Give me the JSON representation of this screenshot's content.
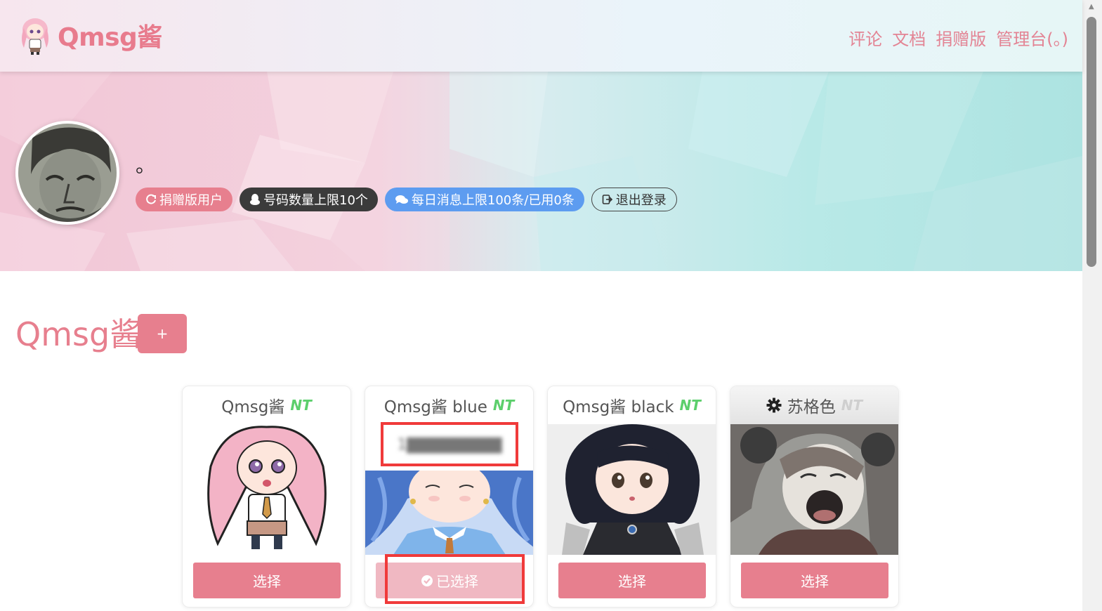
{
  "nav": {
    "brand": "Qmsg酱",
    "links": [
      "评论",
      "文档",
      "捐赠版",
      "管理台(。)"
    ]
  },
  "profile": {
    "username": "。",
    "badges": {
      "donate": "捐赠版用户",
      "qq_limit": "号码数量上限10个",
      "msg_limit": "每日消息上限100条/已用0条",
      "logout": "退出登录"
    }
  },
  "section": {
    "title": "Qmsg酱",
    "add_label": "+"
  },
  "cards": [
    {
      "name": "Qmsg酱",
      "tag": "NT",
      "button": "选择",
      "selected": false
    },
    {
      "name": "Qmsg酱 blue",
      "tag": "NT",
      "qq": "1▇▇▇▇▇▇▇▇",
      "button": "已选择",
      "selected": true
    },
    {
      "name": "Qmsg酱 black",
      "tag": "NT",
      "button": "选择",
      "selected": false
    },
    {
      "name": "苏格色",
      "tag": "NT",
      "button": "选择",
      "selected": false
    }
  ],
  "colors": {
    "accent": "#e77f8e",
    "nt_green": "#5ccf6c",
    "highlight_red": "#f03a3a",
    "msg_blue": "#5d9cf0"
  },
  "icons": [
    "mascot-logo-icon",
    "sync-icon",
    "qq-penguin-icon",
    "chat-bubbles-icon",
    "sign-out-icon",
    "gear-icon",
    "check-circle-icon"
  ]
}
